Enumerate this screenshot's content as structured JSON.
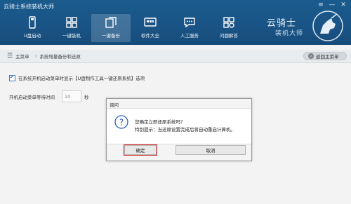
{
  "window": {
    "title": "云骑士系统装机大师",
    "controls": [
      "≡",
      "—",
      "✕"
    ]
  },
  "nav": [
    {
      "label": "U盘启动",
      "icon": "usb-drive-icon",
      "active": false
    },
    {
      "label": "一键装机",
      "icon": "grid-icon",
      "active": false
    },
    {
      "label": "一键备份",
      "icon": "backup-icon",
      "active": true
    },
    {
      "label": "软件大全",
      "icon": "software-icon",
      "active": false
    },
    {
      "label": "人工服务",
      "icon": "chat-icon",
      "active": false
    },
    {
      "label": "问题解答",
      "icon": "question-grid-icon",
      "active": false
    }
  ],
  "logo": {
    "line1": "云骑士",
    "line2": "装机大师"
  },
  "breadcrumb": {
    "menu_icon": "☰",
    "home": "主菜单",
    "current": "系统增量备份和还原"
  },
  "back_button": {
    "label": "返回主菜单"
  },
  "options": {
    "show_boot_menu": {
      "checked": true,
      "label": "在系统开机启动菜单时显示【U盘制作工具一键还原系统】选项"
    },
    "wait_time": {
      "label": "开机启动菜单等待时间",
      "value": "10",
      "unit": "秒"
    }
  },
  "dialog": {
    "title": "询问",
    "message1": "您确定立即还原系统吗？",
    "message2": "特别提示：当还原设置完成后将自动重启计算机。",
    "ok_label": "确定",
    "cancel_label": "取消"
  },
  "colors": {
    "header": "#1a5486",
    "highlight": "#d42626",
    "accent": "#2c6db8"
  }
}
